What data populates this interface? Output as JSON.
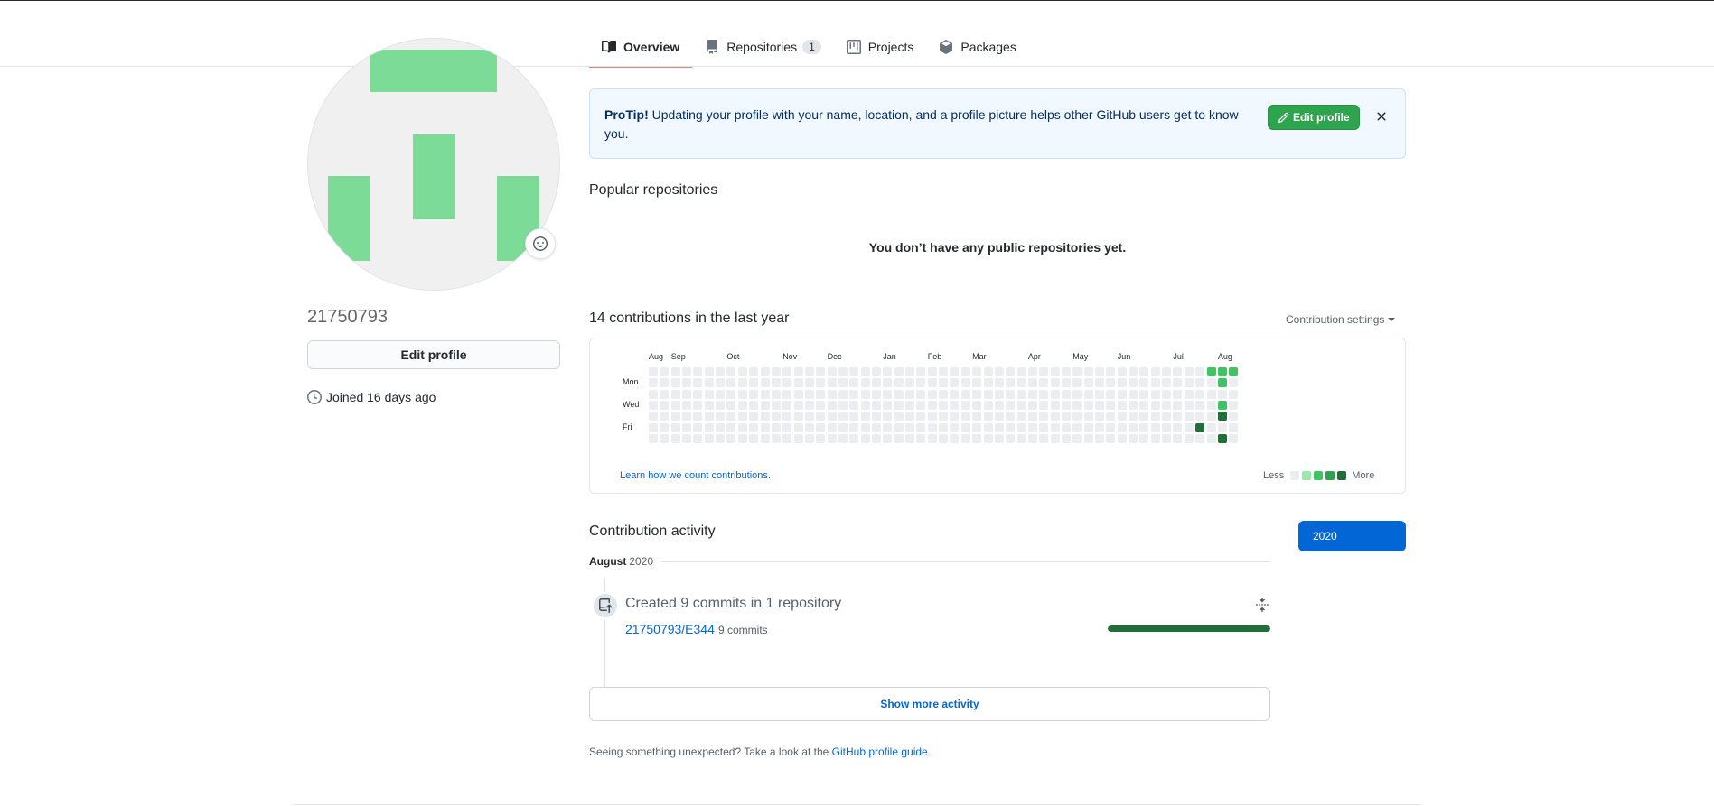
{
  "tabs": [
    {
      "label": "Overview",
      "icon": "book-icon",
      "active": true
    },
    {
      "label": "Repositories",
      "icon": "repo-icon",
      "count": "1"
    },
    {
      "label": "Projects",
      "icon": "project-icon"
    },
    {
      "label": "Packages",
      "icon": "package-icon"
    }
  ],
  "profile": {
    "username": "21750793",
    "edit_label": "Edit profile",
    "joined": "Joined 16 days ago",
    "avatar_color": "#7ddb98"
  },
  "protip": {
    "lead": "ProTip!",
    "text": " Updating your profile with your name, location, and a profile picture helps other GitHub users get to know you.",
    "button": "Edit profile"
  },
  "popular": {
    "title": "Popular repositories",
    "empty": "You don’t have any public repositories yet."
  },
  "contributions": {
    "title": "14 contributions in the last year",
    "settings": "Contribution settings",
    "months": [
      "Aug",
      "Sep",
      "Oct",
      "Nov",
      "Dec",
      "Jan",
      "Feb",
      "Mar",
      "Apr",
      "May",
      "Jun",
      "Jul",
      "Aug"
    ],
    "days": [
      "Mon",
      "Wed",
      "Fri"
    ],
    "learn": "Learn how we count contributions.",
    "legend_less": "Less",
    "legend_more": "More",
    "colors": [
      "#ebedf0",
      "#9be9a8",
      "#40c463",
      "#30a14e",
      "#216e39"
    ],
    "active_cells": [
      {
        "week": 50,
        "day": 0,
        "level": 2
      },
      {
        "week": 51,
        "day": 0,
        "level": 2
      },
      {
        "week": 52,
        "day": 0,
        "level": 2
      },
      {
        "week": 51,
        "day": 1,
        "level": 2
      },
      {
        "week": 51,
        "day": 3,
        "level": 2
      },
      {
        "week": 51,
        "day": 4,
        "level": 4
      },
      {
        "week": 49,
        "day": 5,
        "level": 4
      },
      {
        "week": 51,
        "day": 6,
        "level": 4
      }
    ]
  },
  "activity": {
    "title": "Contribution activity",
    "year": "2020",
    "month": "August",
    "month_year": "2020",
    "summary": "Created 9 commits in 1 repository",
    "repo": "21750793/E344",
    "commits": "9 commits",
    "progress": 1.0,
    "show_more": "Show more activity",
    "footer_text": "Seeing something unexpected? Take a look at the ",
    "footer_link": "GitHub profile guide",
    "footer_end": "."
  }
}
